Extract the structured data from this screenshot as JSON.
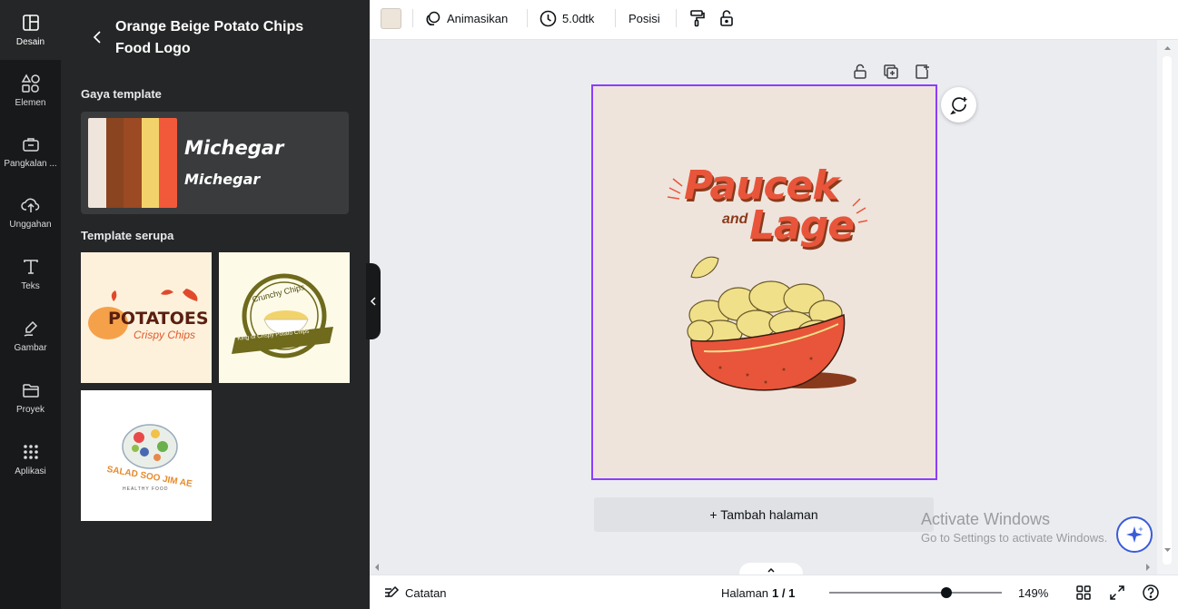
{
  "rail": [
    {
      "id": "design",
      "label": "Desain",
      "icon": "layout-icon"
    },
    {
      "id": "elements",
      "label": "Elemen",
      "icon": "shapes-icon"
    },
    {
      "id": "brand",
      "label": "Pangkalan ...",
      "icon": "briefcase-icon"
    },
    {
      "id": "uploads",
      "label": "Unggahan",
      "icon": "cloud-upload-icon"
    },
    {
      "id": "text",
      "label": "Teks",
      "icon": "text-icon"
    },
    {
      "id": "draw",
      "label": "Gambar",
      "icon": "pen-icon"
    },
    {
      "id": "projects",
      "label": "Proyek",
      "icon": "folder-icon"
    },
    {
      "id": "apps",
      "label": "Aplikasi",
      "icon": "grid-icon"
    }
  ],
  "panel": {
    "title": "Orange Beige Potato Chips Food Logo",
    "style_heading": "Gaya template",
    "font_sample_1": "Michegar",
    "font_sample_2": "Michegar",
    "palette": [
      "#efe5dc",
      "#8a4420",
      "#9b4a23",
      "#f2d36b",
      "#f2593a"
    ],
    "similar_heading": "Template serupa",
    "thumbs": [
      {
        "line1": "POTATOES",
        "line2": "Crispy Chips"
      },
      {
        "line1": "Crunchy Chips",
        "line2": "King of Crispy Potato Chips"
      },
      {
        "line1": "SALAD SOO JIM AE",
        "line2": "HEALTHY FOOD"
      }
    ]
  },
  "toolbar": {
    "animate": "Animasikan",
    "duration": "5.0dtk",
    "position": "Posisi"
  },
  "canvas": {
    "logo_line1": "Paucek",
    "logo_and": "and",
    "logo_line2": "Lage",
    "add_page": "+ Tambah halaman"
  },
  "watermark": {
    "line1": "Activate Windows",
    "line2": "Go to Settings to activate Windows."
  },
  "bottombar": {
    "notes": "Catatan",
    "page_prefix": "Halaman",
    "page_value": "1 / 1",
    "zoom": "149%",
    "zoom_fraction": 0.68
  },
  "colors": {
    "accent": "#8b3dff",
    "logo_orange": "#e8553a",
    "logo_dark": "#8a3a1c",
    "chip": "#f0e08a"
  }
}
